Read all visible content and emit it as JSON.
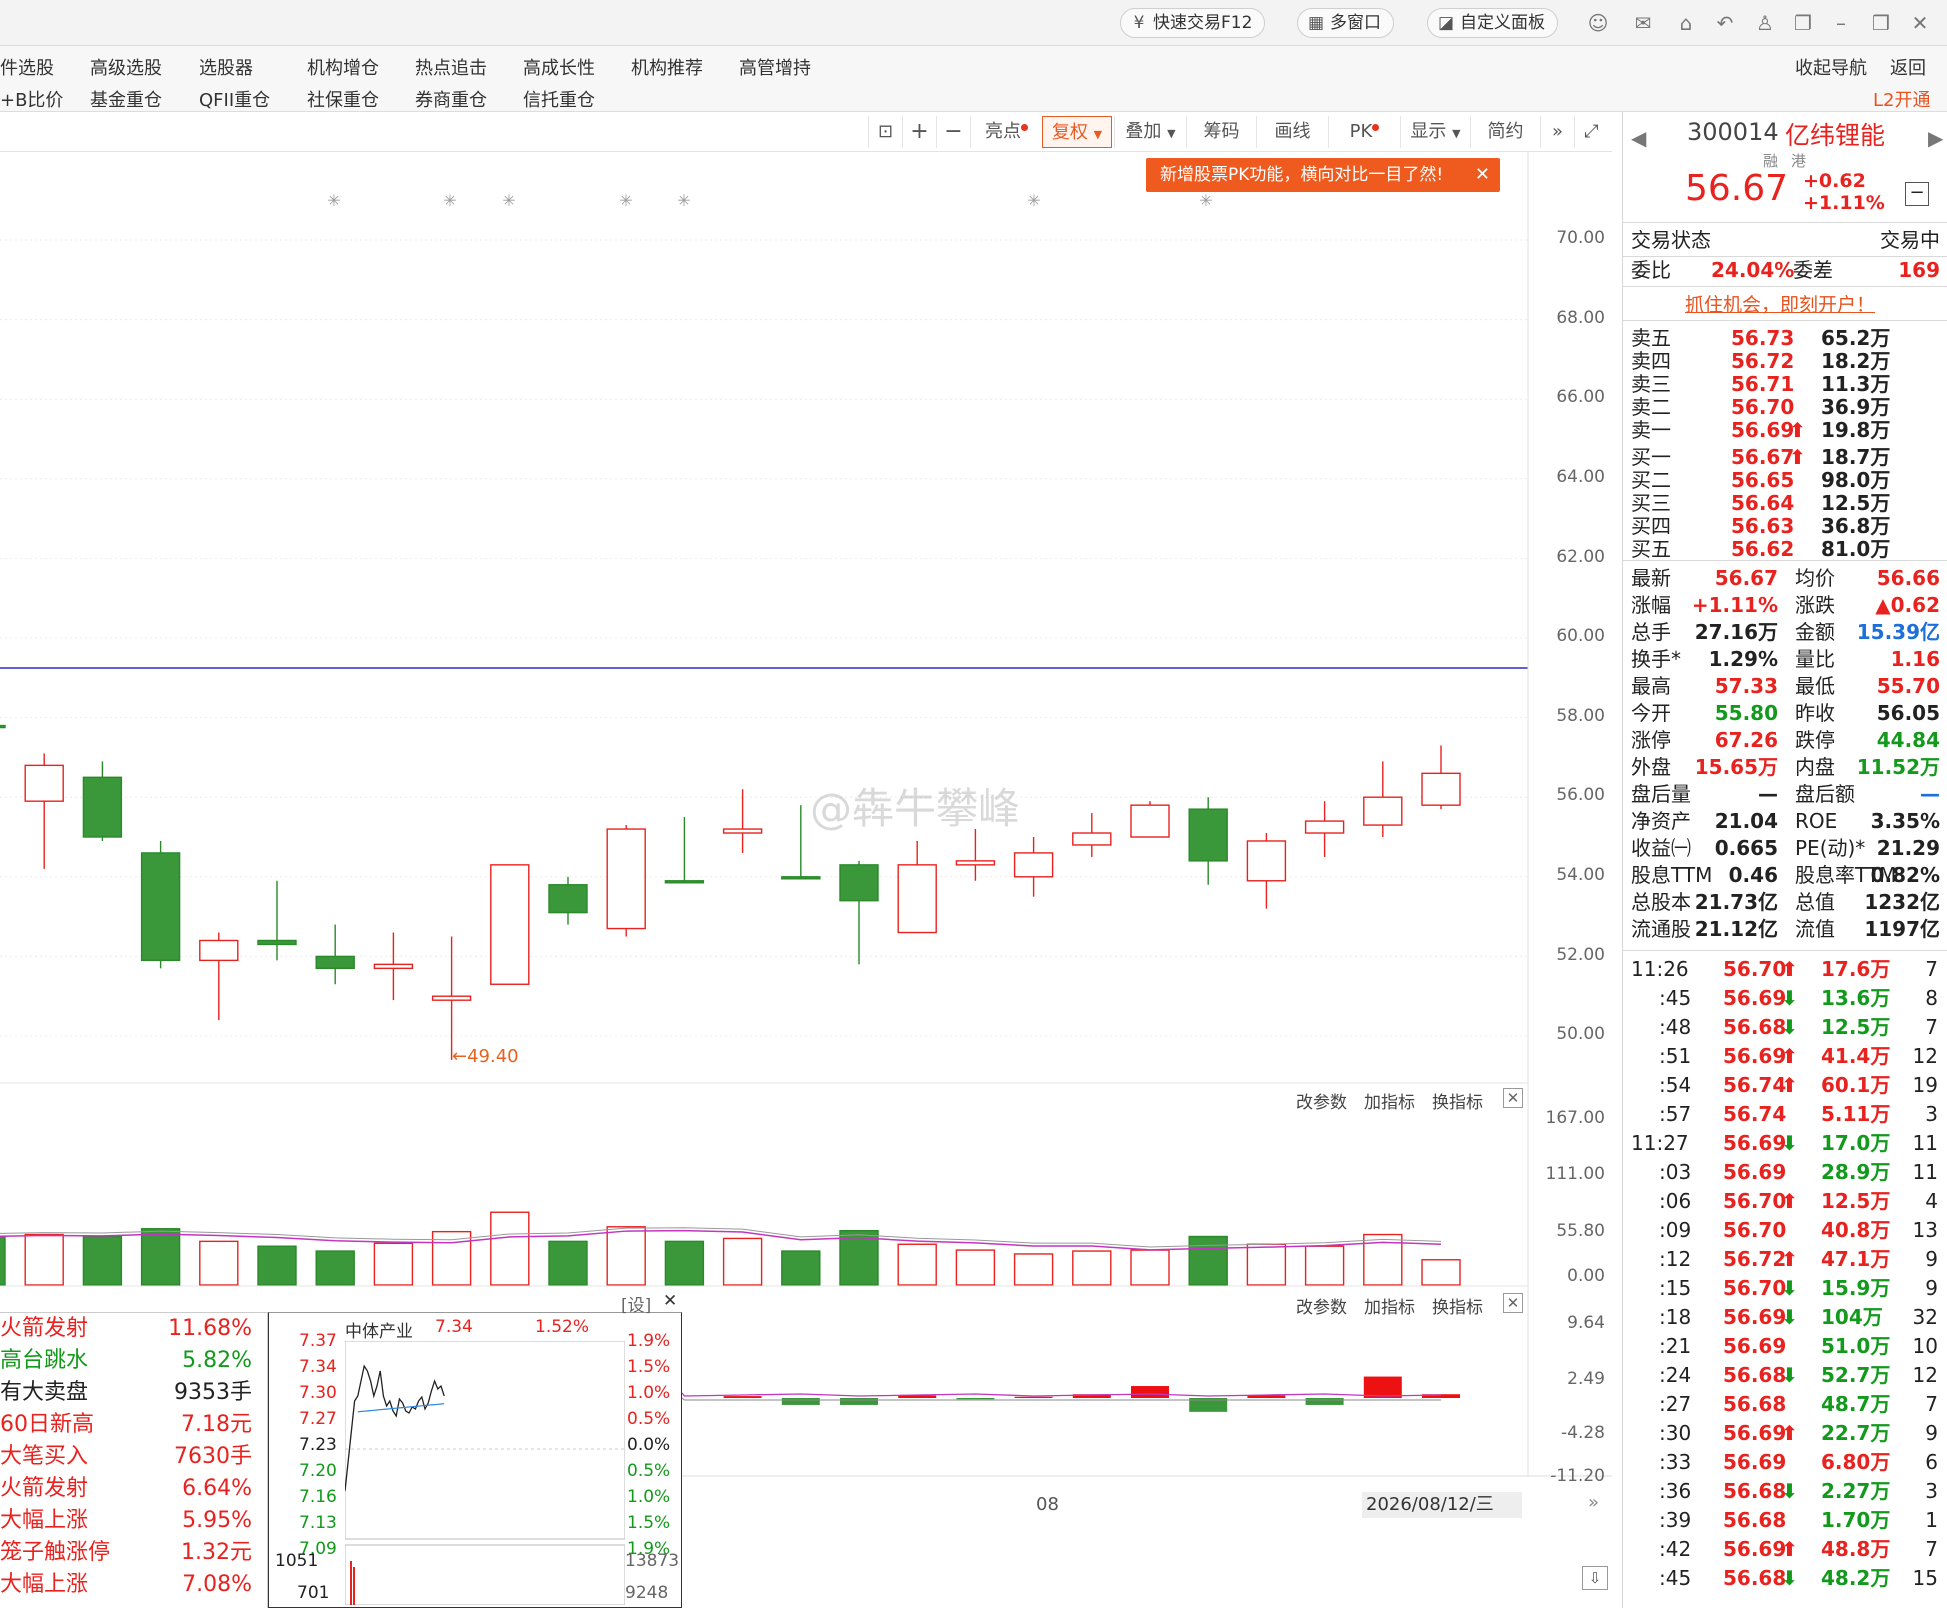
{
  "topbar": {
    "quick_trade": "快速交易F12",
    "multi_window": "多窗口",
    "custom_panel": "自定义面板"
  },
  "nav": {
    "row1": [
      "件选股",
      "高级选股",
      "选股器",
      "机构增仓",
      "热点追击",
      "高成长性",
      "机构推荐",
      "高管增持"
    ],
    "row2": [
      "+B比价",
      "基金重仓",
      "QFII重仓",
      "社保重仓",
      "券商重仓",
      "信托重仓"
    ],
    "collapse": "收起导航",
    "back": "返回",
    "l2": "L2开通"
  },
  "chart_toolbar": {
    "bright": "亮点",
    "adjust": "复权",
    "overlay": "叠加",
    "chips": "筹码",
    "draw": "画线",
    "pk": "PK",
    "display": "显示",
    "simple": "简约",
    "pk_tip": "新增股票PK功能，横向对比一目了然!"
  },
  "chart": {
    "price_axis": [
      "70.00",
      "68.00",
      "66.00",
      "64.00",
      "62.00",
      "60.00",
      "58.00",
      "56.00",
      "54.00",
      "52.00",
      "50.00"
    ],
    "low_label": "←49.40",
    "volume_axis": [
      "167.00",
      "111.00",
      "55.80",
      "0.00"
    ],
    "macd_axis": [
      "9.64",
      "2.49",
      "-4.28",
      "-11.20"
    ],
    "change_param": "改参数",
    "add_indicator": "加指标",
    "switch_indicator": "换指标",
    "date_tick": "08",
    "date_label": "2026/08/12/三",
    "set_label": "[设]",
    "watermark": "@犇牛攀峰"
  },
  "chart_data": {
    "type": "candlestick",
    "ylim": [
      49.0,
      71.0
    ],
    "candles": [
      {
        "o": 57.8,
        "c": 57.8,
        "h": 58.4,
        "l": 55.9,
        "dir": "down"
      },
      {
        "o": 55.9,
        "c": 56.8,
        "h": 57.1,
        "l": 54.2,
        "dir": "up"
      },
      {
        "o": 56.5,
        "c": 55.0,
        "h": 56.9,
        "l": 54.9,
        "dir": "down"
      },
      {
        "o": 54.6,
        "c": 51.9,
        "h": 54.9,
        "l": 51.7,
        "dir": "down"
      },
      {
        "o": 51.9,
        "c": 52.4,
        "h": 52.6,
        "l": 50.4,
        "dir": "up"
      },
      {
        "o": 52.4,
        "c": 52.3,
        "h": 53.9,
        "l": 51.9,
        "dir": "down"
      },
      {
        "o": 52.0,
        "c": 51.7,
        "h": 52.8,
        "l": 51.3,
        "dir": "down"
      },
      {
        "o": 51.7,
        "c": 51.8,
        "h": 52.6,
        "l": 50.9,
        "dir": "up"
      },
      {
        "o": 50.9,
        "c": 51.0,
        "h": 52.5,
        "l": 49.4,
        "dir": "up"
      },
      {
        "o": 51.3,
        "c": 54.3,
        "h": 54.3,
        "l": 51.3,
        "dir": "up"
      },
      {
        "o": 53.8,
        "c": 53.1,
        "h": 54.0,
        "l": 52.8,
        "dir": "down"
      },
      {
        "o": 52.7,
        "c": 55.2,
        "h": 55.3,
        "l": 52.5,
        "dir": "up"
      },
      {
        "o": 53.9,
        "c": 53.9,
        "h": 55.5,
        "l": 53.9,
        "dir": "down"
      },
      {
        "o": 55.1,
        "c": 55.2,
        "h": 56.2,
        "l": 54.6,
        "dir": "up"
      },
      {
        "o": 54.0,
        "c": 54.0,
        "h": 55.8,
        "l": 54.0,
        "dir": "down"
      },
      {
        "o": 54.3,
        "c": 53.4,
        "h": 54.4,
        "l": 51.8,
        "dir": "down"
      },
      {
        "o": 52.6,
        "c": 54.3,
        "h": 54.9,
        "l": 52.6,
        "dir": "up"
      },
      {
        "o": 54.3,
        "c": 54.4,
        "h": 55.2,
        "l": 53.9,
        "dir": "up"
      },
      {
        "o": 54.0,
        "c": 54.6,
        "h": 55.0,
        "l": 53.5,
        "dir": "up"
      },
      {
        "o": 54.8,
        "c": 55.1,
        "h": 55.6,
        "l": 54.5,
        "dir": "up"
      },
      {
        "o": 55.0,
        "c": 55.8,
        "h": 55.9,
        "l": 55.0,
        "dir": "up"
      },
      {
        "o": 55.7,
        "c": 54.4,
        "h": 56.0,
        "l": 53.8,
        "dir": "down"
      },
      {
        "o": 53.9,
        "c": 54.9,
        "h": 55.1,
        "l": 53.2,
        "dir": "up"
      },
      {
        "o": 55.1,
        "c": 55.4,
        "h": 55.9,
        "l": 54.5,
        "dir": "up"
      },
      {
        "o": 55.3,
        "c": 56.0,
        "h": 56.9,
        "l": 55.0,
        "dir": "up"
      },
      {
        "o": 55.8,
        "c": 56.6,
        "h": 57.3,
        "l": 55.7,
        "dir": "up"
      }
    ],
    "volume": [
      50,
      52,
      50,
      58,
      45,
      40,
      35,
      43,
      55,
      75,
      45,
      60,
      45,
      48,
      35,
      56,
      42,
      36,
      32,
      35,
      36,
      50,
      42,
      40,
      52,
      26
    ],
    "macd": [
      0,
      0,
      0,
      0,
      0,
      0,
      0,
      0,
      0,
      0,
      0,
      0,
      0,
      0.3,
      -1.1,
      -1.1,
      0.4,
      -0.2,
      0.2,
      0.6,
      1.9,
      -2.2,
      0.4,
      -1.1,
      3.4,
      0.6
    ]
  },
  "quote": {
    "code": "300014",
    "name": "亿纬锂能",
    "tags": [
      "融",
      "港"
    ],
    "price": "56.67",
    "change": "+0.62",
    "pct": "+1.11%",
    "status_label": "交易状态",
    "status_value": "交易中",
    "wb_label": "委比",
    "wb_value": "24.04%",
    "wc_label": "委差",
    "wc_value": "169",
    "promo": "抓住机会，即刻开户！"
  },
  "orderbook": [
    {
      "label": "卖五",
      "price": "56.73",
      "vol": "65.2万",
      "arrow": ""
    },
    {
      "label": "卖四",
      "price": "56.72",
      "vol": "18.2万",
      "arrow": ""
    },
    {
      "label": "卖三",
      "price": "56.71",
      "vol": "11.3万",
      "arrow": ""
    },
    {
      "label": "卖二",
      "price": "56.70",
      "vol": "36.9万",
      "arrow": ""
    },
    {
      "label": "卖一",
      "price": "56.69",
      "vol": "19.8万",
      "arrow": "⬆"
    },
    {
      "label": "买一",
      "price": "56.67",
      "vol": "18.7万",
      "arrow": "⬆"
    },
    {
      "label": "买二",
      "price": "56.65",
      "vol": "98.0万",
      "arrow": ""
    },
    {
      "label": "买三",
      "price": "56.64",
      "vol": "12.5万",
      "arrow": ""
    },
    {
      "label": "买四",
      "price": "56.63",
      "vol": "36.8万",
      "arrow": ""
    },
    {
      "label": "买五",
      "price": "56.62",
      "vol": "81.0万",
      "arrow": ""
    }
  ],
  "stats": [
    {
      "l1": "最新",
      "v1": "56.67",
      "c1": "red",
      "l2": "均价",
      "v2": "56.66",
      "c2": "red"
    },
    {
      "l1": "涨幅",
      "v1": "+1.11%",
      "c1": "red",
      "l2": "涨跌",
      "v2": "▲0.62",
      "c2": "red"
    },
    {
      "l1": "总手",
      "v1": "27.16万",
      "c1": "dark",
      "l2": "金额",
      "v2": "15.39亿",
      "c2": "blue"
    },
    {
      "l1": "换手*",
      "v1": "1.29%",
      "c1": "dark",
      "l2": "量比",
      "v2": "1.16",
      "c2": "red"
    },
    {
      "l1": "最高",
      "v1": "57.33",
      "c1": "red",
      "l2": "最低",
      "v2": "55.70",
      "c2": "red"
    },
    {
      "l1": "今开",
      "v1": "55.80",
      "c1": "green",
      "l2": "昨收",
      "v2": "56.05",
      "c2": "dark"
    },
    {
      "l1": "涨停",
      "v1": "67.26",
      "c1": "red",
      "l2": "跌停",
      "v2": "44.84",
      "c2": "green"
    },
    {
      "l1": "外盘",
      "v1": "15.65万",
      "c1": "red",
      "l2": "内盘",
      "v2": "11.52万",
      "c2": "green"
    },
    {
      "l1": "盘后量",
      "v1": "—",
      "c1": "dark",
      "l2": "盘后额",
      "v2": "—",
      "c2": "blue"
    },
    {
      "l1": "净资产",
      "v1": "21.04",
      "c1": "dark",
      "l2": "ROE",
      "v2": "3.35%",
      "c2": "dark"
    },
    {
      "l1": "收益㈠",
      "v1": "0.665",
      "c1": "dark",
      "l2": "PE(动)*",
      "v2": "21.29",
      "c2": "dark"
    },
    {
      "l1": "股息TTM",
      "v1": "0.46",
      "c1": "dark",
      "l2": "股息率TTM",
      "v2": "0.82%",
      "c2": "dark"
    },
    {
      "l1": "总股本",
      "v1": "21.73亿",
      "c1": "dark",
      "l2": "总值",
      "v2": "1232亿",
      "c2": "dark"
    },
    {
      "l1": "流通股",
      "v1": "21.12亿",
      "c1": "dark",
      "l2": "流值",
      "v2": "1197亿",
      "c2": "dark"
    }
  ],
  "ticks": [
    {
      "t": "11:26",
      "p": "56.70",
      "a": "⬆",
      "ac": "red",
      "v": "17.6万",
      "vc": "red",
      "n": "7"
    },
    {
      "t": ":45",
      "p": "56.69",
      "a": "⬇",
      "ac": "green",
      "v": "13.6万",
      "vc": "green",
      "n": "8"
    },
    {
      "t": ":48",
      "p": "56.68",
      "a": "⬇",
      "ac": "green",
      "v": "12.5万",
      "vc": "green",
      "n": "7"
    },
    {
      "t": ":51",
      "p": "56.69",
      "a": "⬆",
      "ac": "red",
      "v": "41.4万",
      "vc": "red",
      "n": "12"
    },
    {
      "t": ":54",
      "p": "56.74",
      "a": "⬆",
      "ac": "red",
      "v": "60.1万",
      "vc": "red",
      "n": "19"
    },
    {
      "t": ":57",
      "p": "56.74",
      "a": "",
      "ac": "red",
      "v": "5.11万",
      "vc": "red",
      "n": "3"
    },
    {
      "t": "11:27",
      "p": "56.69",
      "a": "⬇",
      "ac": "green",
      "v": "17.0万",
      "vc": "green",
      "n": "11"
    },
    {
      "t": ":03",
      "p": "56.69",
      "a": "",
      "ac": "red",
      "v": "28.9万",
      "vc": "green",
      "n": "11"
    },
    {
      "t": ":06",
      "p": "56.70",
      "a": "⬆",
      "ac": "red",
      "v": "12.5万",
      "vc": "red",
      "n": "4"
    },
    {
      "t": ":09",
      "p": "56.70",
      "a": "",
      "ac": "red",
      "v": "40.8万",
      "vc": "red",
      "n": "13"
    },
    {
      "t": ":12",
      "p": "56.72",
      "a": "⬆",
      "ac": "red",
      "v": "47.1万",
      "vc": "red",
      "n": "9"
    },
    {
      "t": ":15",
      "p": "56.70",
      "a": "⬇",
      "ac": "green",
      "v": "15.9万",
      "vc": "green",
      "n": "9"
    },
    {
      "t": ":18",
      "p": "56.69",
      "a": "⬇",
      "ac": "green",
      "v": "104万",
      "vc": "green",
      "n": "32"
    },
    {
      "t": ":21",
      "p": "56.69",
      "a": "",
      "ac": "red",
      "v": "51.0万",
      "vc": "green",
      "n": "10"
    },
    {
      "t": ":24",
      "p": "56.68",
      "a": "⬇",
      "ac": "green",
      "v": "52.7万",
      "vc": "green",
      "n": "12"
    },
    {
      "t": ":27",
      "p": "56.68",
      "a": "",
      "ac": "red",
      "v": "48.7万",
      "vc": "green",
      "n": "7"
    },
    {
      "t": ":30",
      "p": "56.69",
      "a": "⬆",
      "ac": "red",
      "v": "22.7万",
      "vc": "green",
      "n": "9"
    },
    {
      "t": ":33",
      "p": "56.69",
      "a": "",
      "ac": "red",
      "v": "6.80万",
      "vc": "red",
      "n": "6"
    },
    {
      "t": ":36",
      "p": "56.68",
      "a": "⬇",
      "ac": "green",
      "v": "2.27万",
      "vc": "green",
      "n": "3"
    },
    {
      "t": ":39",
      "p": "56.68",
      "a": "",
      "ac": "red",
      "v": "1.70万",
      "vc": "green",
      "n": "1"
    },
    {
      "t": ":42",
      "p": "56.69",
      "a": "⬆",
      "ac": "red",
      "v": "48.8万",
      "vc": "red",
      "n": "7"
    },
    {
      "t": ":45",
      "p": "56.68",
      "a": "⬇",
      "ac": "green",
      "v": "48.2万",
      "vc": "green",
      "n": "15"
    }
  ],
  "alerts": [
    {
      "name": "火箭发射",
      "nc": "red",
      "val": "11.68%",
      "vc": "red"
    },
    {
      "name": "高台跳水",
      "nc": "green",
      "val": "5.82%",
      "vc": "green"
    },
    {
      "name": "有大卖盘",
      "nc": "dark",
      "val": "9353手",
      "vc": "dark"
    },
    {
      "name": "60日新高",
      "nc": "red",
      "val": "7.18元",
      "vc": "red"
    },
    {
      "name": "大笔买入",
      "nc": "red",
      "val": "7630手",
      "vc": "red"
    },
    {
      "name": "火箭发射",
      "nc": "red",
      "val": "6.64%",
      "vc": "red"
    },
    {
      "name": "大幅上涨",
      "nc": "red",
      "val": "5.95%",
      "vc": "red"
    },
    {
      "name": "笼子触涨停",
      "nc": "red",
      "val": "1.32元",
      "vc": "red"
    },
    {
      "name": "大幅上涨",
      "nc": "red",
      "val": "7.08%",
      "vc": "red"
    }
  ],
  "mini": {
    "name": "中体产业",
    "price": "7.34",
    "pct": "1.52%",
    "left_axis": [
      "7.37",
      "7.34",
      "7.30",
      "7.27",
      "7.23",
      "7.20",
      "7.16",
      "7.13",
      "7.09"
    ],
    "right_axis": [
      "1.9%",
      "1.5%",
      "1.0%",
      "0.5%",
      "0.0%",
      "0.5%",
      "1.0%",
      "1.5%",
      "1.9%"
    ],
    "vol_left": [
      "1051",
      "701"
    ],
    "vol_right": [
      "13873",
      "9248"
    ]
  }
}
